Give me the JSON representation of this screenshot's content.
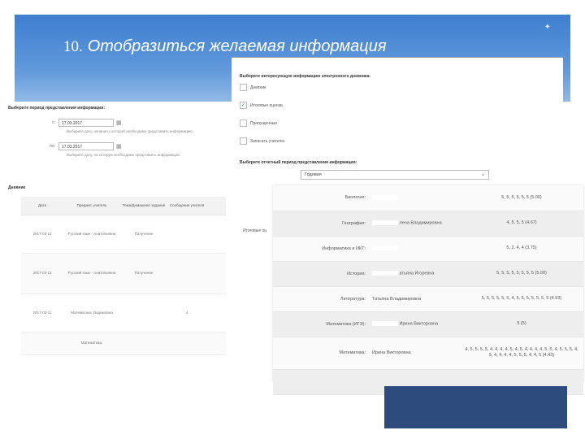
{
  "slide": {
    "number": "10.",
    "title": "Отобразиться желаемая информация"
  },
  "left": {
    "period_heading": "Выберите период представления информации:",
    "from_prefix": "с:",
    "from_date": "17.03.2017",
    "from_hint": "Выберите дату, начиная с которой необходимо представить информацию",
    "to_prefix": "по:",
    "to_date": "17.03.2017",
    "to_hint": "Выберите дату, по которую необходимо представить информацию",
    "diary_heading": "Дневник",
    "columns": [
      "Дата",
      "Предмет, учитель",
      "Тема/Домашнее задание",
      "Сообщение учителя"
    ],
    "rows": [
      {
        "date": "2017-03-11",
        "subject": "Русский язык - Анатольевна",
        "topic": "Получение",
        "note": ""
      },
      {
        "date": "2017-03-11",
        "subject": "Русский язык - Анатольевна",
        "topic": "Получение",
        "note": ""
      },
      {
        "date": "2017-03-11",
        "subject": "Математика, Вадимовна",
        "topic": "",
        "note": "4"
      },
      {
        "date": "",
        "subject": "Математика,",
        "topic": "",
        "note": ""
      }
    ]
  },
  "middle": {
    "heading": "Выберите интересующую информацию электронного дневника:",
    "opt_diary": "Дневник",
    "opt_final": "Итоговые оценки",
    "opt_absence": "Пропущенные",
    "opt_teacher": "Записать учителю",
    "period_heading": "Выберите отчетный период представления информации:",
    "period_value": "Годовая",
    "final_label": "Итоговые оц"
  },
  "grades": [
    {
      "subject": "Биология:",
      "teacher": "",
      "marks": "5, 5, 5, 5, 5, 5 (5.00)"
    },
    {
      "subject": "География:",
      "teacher": "лена Владимировна",
      "marks": "4, 5, 5, 5 (4.67)"
    },
    {
      "subject": "Информатика и ИКТ:",
      "teacher": "",
      "marks": "5, 2, 4, 4 (3.75)"
    },
    {
      "subject": "История:",
      "teacher": "атьяна Игоревна",
      "marks": "5, 5, 5, 5, 5, 5, 5, 5 (5.00)"
    },
    {
      "subject": "Литература:",
      "teacher": "Татьяна Владимировна",
      "marks": "5, 5, 5, 5, 5, 5, 4, 5, 5, 5, 5, 5, 5, 5 (4.93)"
    },
    {
      "subject": "Математика (ИГЭ):",
      "teacher": "Ирина Викторовна",
      "marks": "5 (5)"
    },
    {
      "subject": "Математика:",
      "teacher": "Ирина Викторовна",
      "marks": "4, 5, 5, 5, 5, 4, 4, 4, 4, 5, 4, 5, 4, 4, 4, 4, 5, 5, 4, 5, 5, 5, 4, 5, 4, 4, 4, 4, 5, 5, 5, 4, 4, 5 (4.43)"
    },
    {
      "subject": "",
      "teacher": "",
      "marks": ""
    }
  ]
}
